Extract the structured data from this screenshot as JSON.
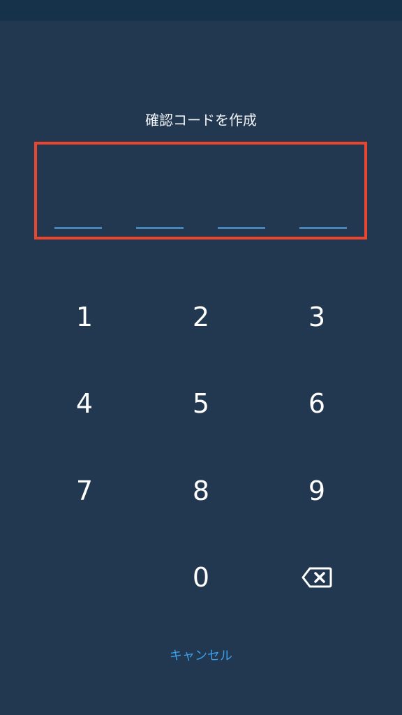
{
  "header": {
    "title": "確認コードを作成"
  },
  "code_input": {
    "slot_count": 4,
    "entered": ""
  },
  "keypad": {
    "keys": [
      "1",
      "2",
      "3",
      "4",
      "5",
      "6",
      "7",
      "8",
      "9",
      "0"
    ],
    "backspace_icon": "backspace-icon"
  },
  "footer": {
    "cancel_label": "キャンセル"
  },
  "colors": {
    "background": "#223750",
    "highlight_border": "#e8472d",
    "slot_line": "#4a86b5",
    "link": "#3b9ee8"
  }
}
